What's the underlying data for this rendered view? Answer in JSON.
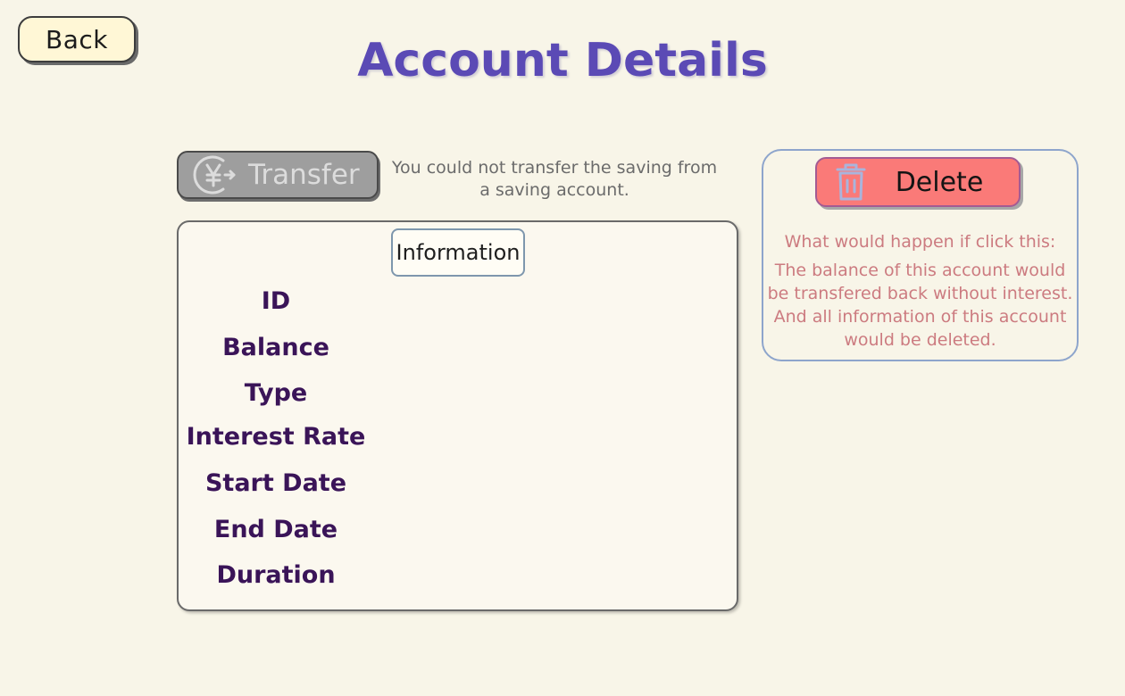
{
  "header": {
    "back_label": "Back",
    "title": "Account Details"
  },
  "transfer": {
    "label": "Transfer",
    "icon": "yen-transfer-icon",
    "disabled": true,
    "note": "You could not transfer the saving from a saving account."
  },
  "info": {
    "tab_label": "Information",
    "fields": [
      {
        "label": "ID"
      },
      {
        "label": "Balance"
      },
      {
        "label": "Type"
      },
      {
        "label": "Interest Rate"
      },
      {
        "label": "Start Date"
      },
      {
        "label": "End Date"
      },
      {
        "label": "Duration"
      }
    ]
  },
  "delete": {
    "label": "Delete",
    "icon": "trash-icon",
    "warning_title": "What would happen if click this:",
    "warning_body": "The balance of this account would be transfered back without interest. And all information of this account would be deleted."
  },
  "colors": {
    "background": "#f8f5e8",
    "title": "#5b4ab5",
    "delete_button": "#fa7a78",
    "warning_text": "#cc7b80",
    "field_label": "#3a1458"
  }
}
